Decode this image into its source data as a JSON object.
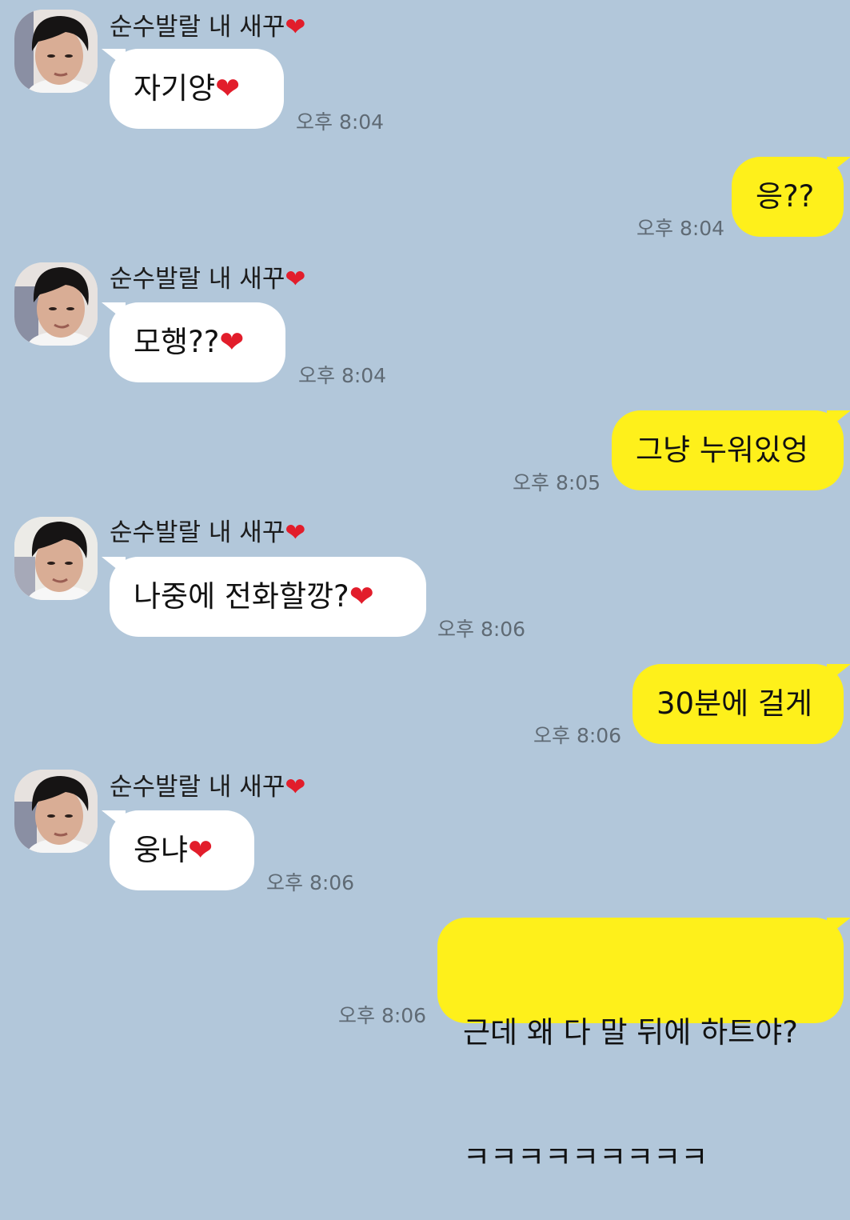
{
  "messages": [
    {
      "side": "in",
      "sender": "순수발랄 내 새꾸",
      "sender_heart": "❤",
      "text": "자기양",
      "text_heart": "❤",
      "time": "오후 8:04"
    },
    {
      "side": "out",
      "text": "응??",
      "time": "오후 8:04"
    },
    {
      "side": "in",
      "sender": "순수발랄 내 새꾸",
      "sender_heart": "❤",
      "text": "모행??",
      "text_heart": "❤",
      "time": "오후 8:04"
    },
    {
      "side": "out",
      "text": "그냥 누워있엉",
      "time": "오후 8:05"
    },
    {
      "side": "in",
      "sender": "순수발랄 내 새꾸",
      "sender_heart": "❤",
      "text": "나중에 전화할깡?",
      "text_heart": "❤",
      "time": "오후 8:06"
    },
    {
      "side": "out",
      "text": "30분에 걸게",
      "time": "오후 8:06"
    },
    {
      "side": "in",
      "sender": "순수발랄 내 새꾸",
      "sender_heart": "❤",
      "text": "웅냐",
      "text_heart": "❤",
      "time": "오후 8:06"
    },
    {
      "side": "out",
      "text_line1": "근데 왜 다 말 뒤에 하트야?",
      "text_line2": "ㅋㅋㅋㅋㅋㅋㅋㅋㅋ",
      "time": "오후 8:06"
    }
  ],
  "colors": {
    "background": "#b2c7da",
    "incoming_bubble": "#ffffff",
    "outgoing_bubble": "#fef01b",
    "heart": "#e21d2b"
  },
  "icons": {
    "avatar": "profile-photo",
    "heart": "heart-emoji"
  }
}
